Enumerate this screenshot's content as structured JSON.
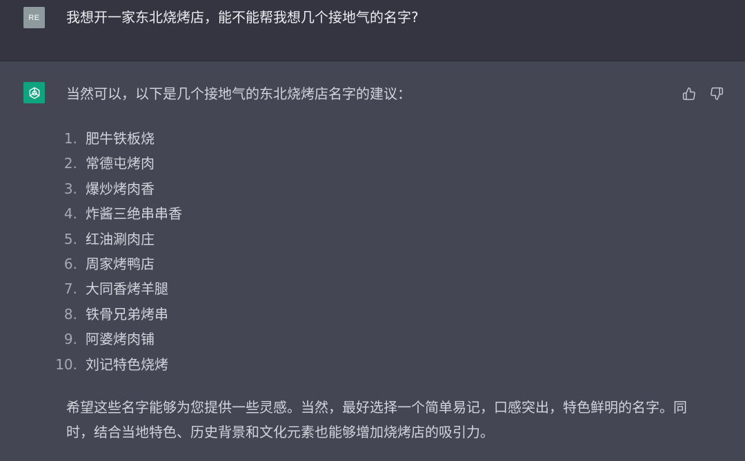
{
  "user": {
    "avatar_initials": "RE",
    "message": "我想开一家东北烧烤店，能不能帮我想几个接地气的名字?"
  },
  "assistant": {
    "avatar_icon": "openai-logo-icon",
    "brand_color": "#10a37f",
    "intro": "当然可以，以下是几个接地气的东北烧烤店名字的建议：",
    "names": [
      {
        "num": "1.",
        "text": "肥牛铁板烧"
      },
      {
        "num": "2.",
        "text": "常德屯烤肉"
      },
      {
        "num": "3.",
        "text": "爆炒烤肉香"
      },
      {
        "num": "4.",
        "text": "炸酱三绝串串香"
      },
      {
        "num": "5.",
        "text": "红油涮肉庄"
      },
      {
        "num": "6.",
        "text": "周家烤鸭店"
      },
      {
        "num": "7.",
        "text": "大同香烤羊腿"
      },
      {
        "num": "8.",
        "text": "铁骨兄弟烤串"
      },
      {
        "num": "9.",
        "text": "阿婆烤肉铺"
      },
      {
        "num": "10.",
        "text": "刘记特色烧烤"
      }
    ],
    "closing": "希望这些名字能够为您提供一些灵感。当然，最好选择一个简单易记，口感突出，特色鲜明的名字。同时，结合当地特色、历史背景和文化元素也能够增加烧烤店的吸引力。"
  },
  "feedback": {
    "thumbs_up_icon": "thumbs-up-icon",
    "thumbs_down_icon": "thumbs-down-icon"
  },
  "colors": {
    "user_bg": "#343541",
    "assistant_bg": "#444654",
    "text": "#d1d5db"
  }
}
